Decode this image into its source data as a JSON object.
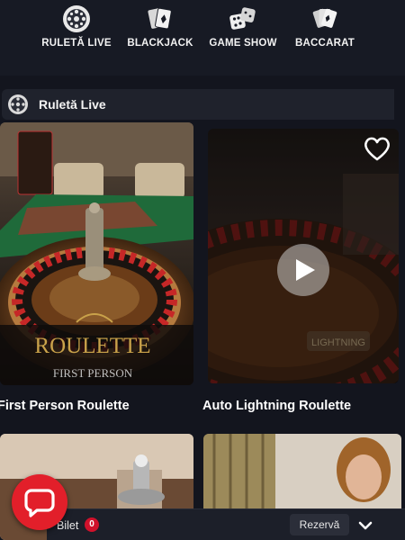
{
  "nav": {
    "items": [
      {
        "label": "RULETĂ LIVE",
        "icon": "roulette-wheel-icon"
      },
      {
        "label": "BLACKJACK",
        "icon": "playing-cards-icon"
      },
      {
        "label": "GAME SHOW",
        "icon": "dice-icon"
      },
      {
        "label": "BACCARAT",
        "icon": "card-fan-icon"
      }
    ]
  },
  "section": {
    "title": "Ruletă Live",
    "icon": "roulette-wheel-icon"
  },
  "games": [
    {
      "title": "First Person Roulette",
      "logo_line1": "ROULETTE",
      "logo_line2": "FIRST PERSON"
    },
    {
      "title": "Auto Lightning Roulette",
      "logo_text": "LIGHTNING"
    },
    {
      "title": ""
    },
    {
      "title": ""
    }
  ],
  "bottom_bar": {
    "ticket_label": "Bilet",
    "ticket_count": "0",
    "reserve_label": "Rezervă"
  },
  "colors": {
    "background": "#13151e",
    "accent_red": "#e21f2a",
    "gold": "#c9a24a",
    "badge_red": "#d0112b"
  },
  "icons": {
    "favorite": "heart-outline-icon",
    "play": "play-icon",
    "chat": "chat-bubble-icon",
    "expand": "chevron-down-icon"
  }
}
